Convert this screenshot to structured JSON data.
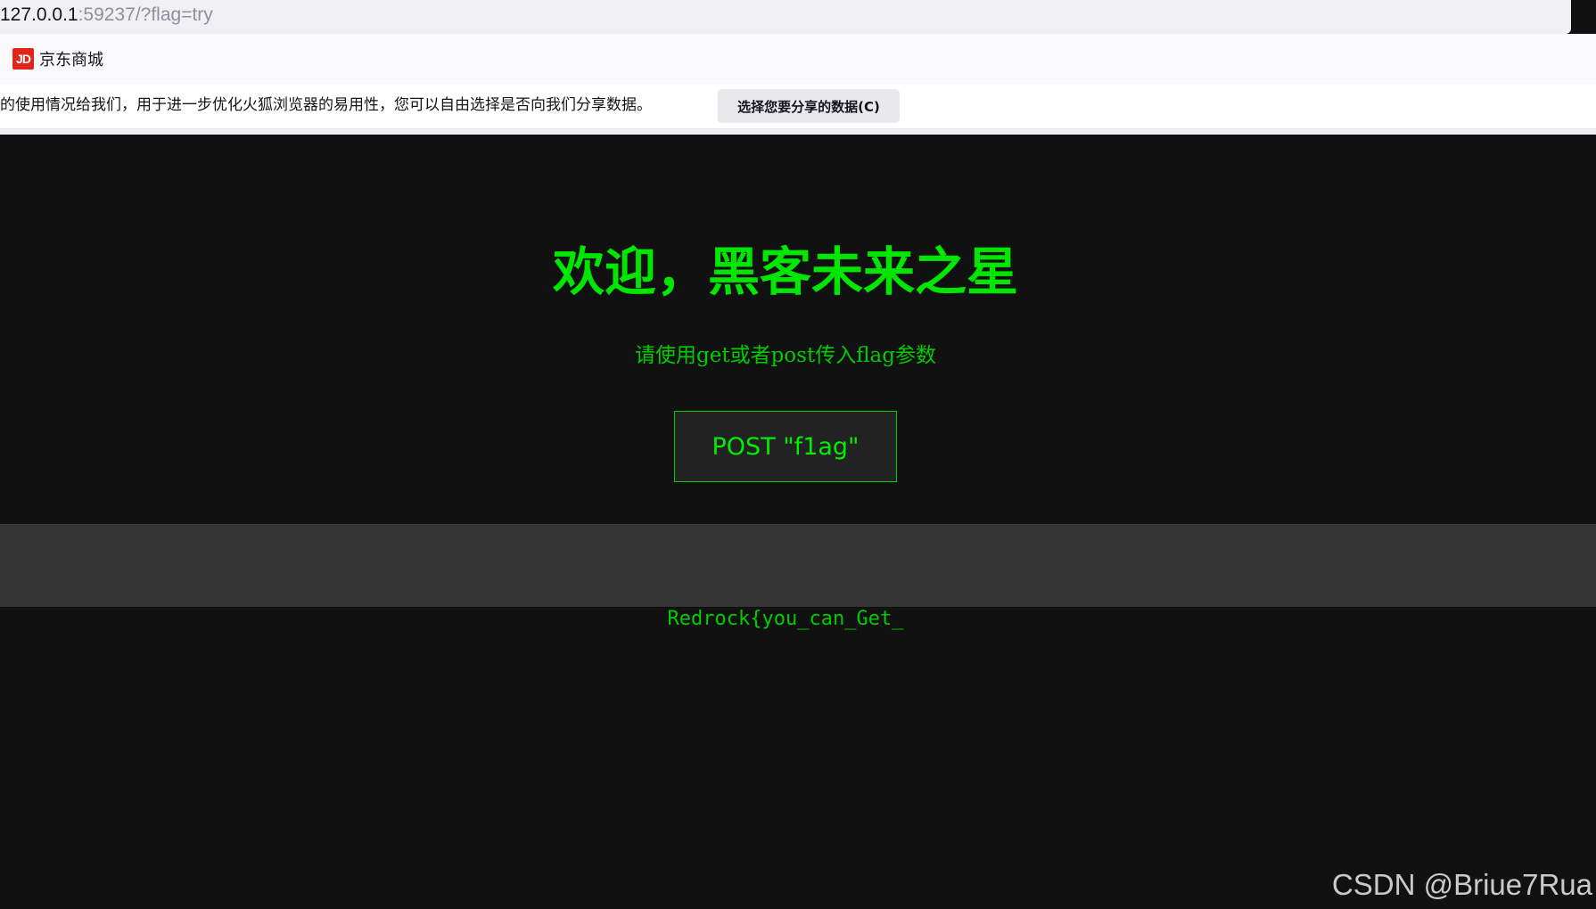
{
  "browser": {
    "url_host": "127.0.0.1",
    "url_rest": ":59237/?flag=try",
    "bookmarks": [
      {
        "icon": "jd-logo-icon",
        "icon_text": "JD",
        "label": "京东商城"
      }
    ],
    "notification": {
      "text": "的使用情况给我们，用于进一步优化火狐浏览器的易用性，您可以自由选择是否向我们分享数据。",
      "button_label": "选择您要分享的数据(C)"
    }
  },
  "page": {
    "title": "欢迎，黑客未来之星",
    "subtitle": "请使用get或者post传入flag参数",
    "post_button_label": "POST \"f1ag\"",
    "output_text": "Redrock{you_can_Get_"
  },
  "watermark": "CSDN @Briue7Rua",
  "colors": {
    "accent_green": "#00e600",
    "background": "#111111",
    "output_box": "#333333"
  }
}
